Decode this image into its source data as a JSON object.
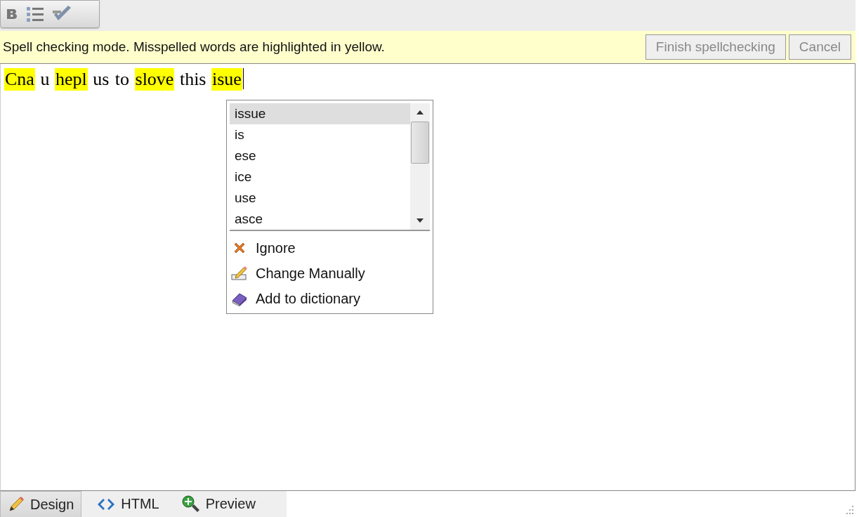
{
  "toolbar": {
    "buttons": [
      {
        "kind": "bold"
      },
      {
        "kind": "list"
      },
      {
        "kind": "spellcheck"
      }
    ]
  },
  "spell_bar": {
    "message": "Spell checking mode. Misspelled words are highlighted in yellow.",
    "buttons": [
      "Finish spellchecking",
      "Cancel"
    ]
  },
  "editor": {
    "words": [
      {
        "text": "Cna",
        "misspelled": true
      },
      {
        "text": "u",
        "misspelled": false
      },
      {
        "text": "hepl",
        "misspelled": true
      },
      {
        "text": "us",
        "misspelled": false
      },
      {
        "text": "to",
        "misspelled": false
      },
      {
        "text": "slove",
        "misspelled": true
      },
      {
        "text": "this",
        "misspelled": false
      },
      {
        "text": "isue",
        "misspelled": true
      }
    ]
  },
  "suggestions": {
    "items": [
      {
        "text": "issue",
        "selected": true
      },
      {
        "text": "is",
        "selected": false
      },
      {
        "text": "ese",
        "selected": false
      },
      {
        "text": "ice",
        "selected": false
      },
      {
        "text": "use",
        "selected": false
      },
      {
        "text": "asce",
        "selected": false
      }
    ],
    "actions": [
      {
        "kind": "ignore",
        "label": "Ignore"
      },
      {
        "kind": "edit",
        "label": "Change Manually"
      },
      {
        "kind": "dictionary",
        "label": "Add to dictionary"
      }
    ]
  },
  "tabs": [
    {
      "kind": "design",
      "label": "Design",
      "selected": true
    },
    {
      "kind": "html",
      "label": "HTML",
      "selected": false
    },
    {
      "kind": "preview",
      "label": "Preview",
      "selected": false
    }
  ]
}
